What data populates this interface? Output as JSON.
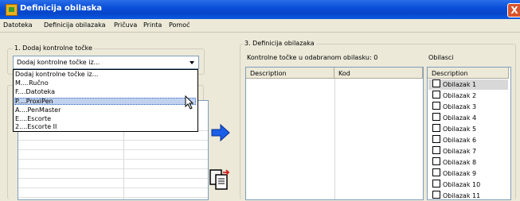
{
  "window": {
    "title": "Definicija obilaska",
    "close_label": "X"
  },
  "menu": [
    "Datoteka",
    "Definicija obilazaka",
    "Pričuva",
    "Printa",
    "Pomoć"
  ],
  "left_panel": {
    "legend": "1. Dodaj kontrolne točke",
    "combo_value": "Dodaj kontrolne točke iz...",
    "dropdown_options": [
      "Dodaj kontrolne točke iz...",
      "M....Ručno",
      "F....Datoteka",
      "P....ProxiPen",
      "A....PenMaster",
      "E....Escorte",
      "2....Escorte II"
    ],
    "selected_option": "P....ProxiPen"
  },
  "right_panel": {
    "legend": "3. Definicija obilazaka",
    "points_label": "Kontrolne točke u odabranom obilasku: 0",
    "obilasci_label": "Obilasci",
    "columns": [
      "Description",
      "Kod"
    ],
    "obilasci_header": "Description",
    "obilasci": [
      "Obilazak 1",
      "Obilazak 2",
      "Obilazak 3",
      "Obilazak 4",
      "Obilazak 5",
      "Obilazak 6",
      "Obilazak 7",
      "Obilazak 8",
      "Obilazak 9",
      "Obilazak 10",
      "Obilazak 11"
    ]
  },
  "icons": {
    "add_arrow": "arrow-right-icon",
    "paste": "paste-icon",
    "app": "app-icon",
    "cursor": "mouse-cursor-icon"
  },
  "colors": {
    "title_bar": "#0a4fd8",
    "selection": "#c1d2ee",
    "arrow": "#1a5ee8"
  }
}
